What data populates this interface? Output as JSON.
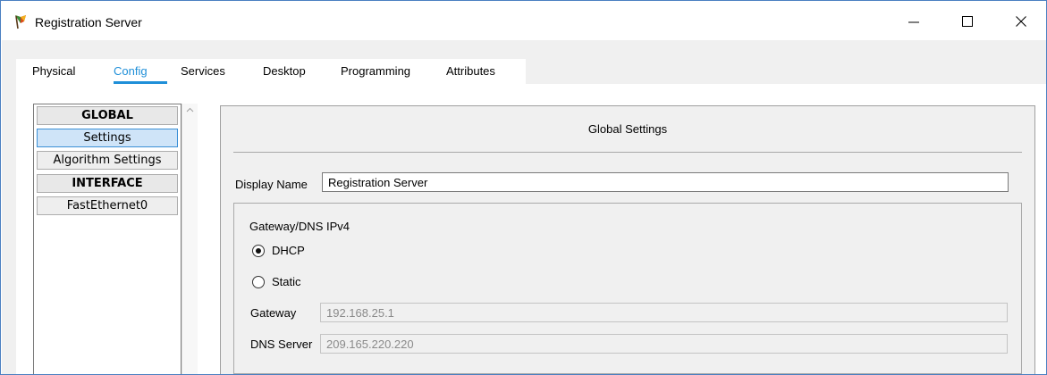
{
  "window": {
    "title": "Registration Server"
  },
  "window_controls": {
    "minimize": "—",
    "maximize": "☐",
    "close": "✕"
  },
  "tabs": [
    {
      "label": "Physical",
      "active": false
    },
    {
      "label": "Config",
      "active": true
    },
    {
      "label": "Services",
      "active": false
    },
    {
      "label": "Desktop",
      "active": false
    },
    {
      "label": "Programming",
      "active": false
    },
    {
      "label": "Attributes",
      "active": false
    }
  ],
  "nav": {
    "items": [
      {
        "label": "GLOBAL",
        "type": "header"
      },
      {
        "label": "Settings",
        "type": "item",
        "selected": true
      },
      {
        "label": "Algorithm Settings",
        "type": "item"
      },
      {
        "label": "INTERFACE",
        "type": "header"
      },
      {
        "label": "FastEthernet0",
        "type": "item"
      }
    ]
  },
  "settings": {
    "title": "Global Settings",
    "display_name_label": "Display Name",
    "display_name_value": "Registration Server",
    "gateway_group": {
      "title": "Gateway/DNS IPv4",
      "dhcp_label": "DHCP",
      "static_label": "Static",
      "selected": "DHCP",
      "gateway_label": "Gateway",
      "gateway_value": "192.168.25.1",
      "dns_label": "DNS Server",
      "dns_value": "209.165.220.220"
    }
  },
  "colors": {
    "accent": "#1f8fd8",
    "window_border": "#4a7fc1",
    "selected_item": "#cfe4f8"
  }
}
